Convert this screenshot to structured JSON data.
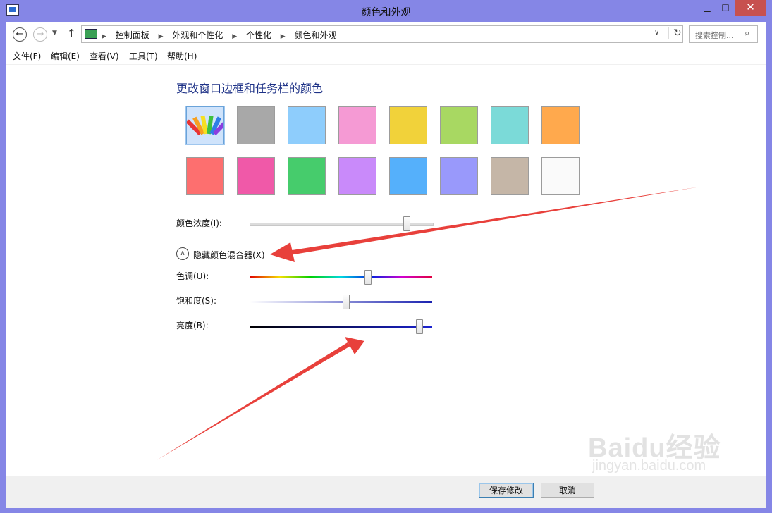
{
  "window": {
    "title": "颜色和外观"
  },
  "nav": {
    "back_icon": "back-arrow-icon",
    "forward_icon": "forward-arrow-icon",
    "up_icon": "up-arrow-icon",
    "breadcrumbs": [
      "控制面板",
      "外观和个性化",
      "个性化",
      "颜色和外观"
    ],
    "search_placeholder": "搜索控制..."
  },
  "menu": [
    "文件(F)",
    "编辑(E)",
    "查看(V)",
    "工具(T)",
    "帮助(H)"
  ],
  "content": {
    "heading": "更改窗口边框和任务栏的颜色",
    "swatches_row1": [
      "custom",
      "#a8a8a8",
      "#8ecdfc",
      "#f59ad4",
      "#f1d23a",
      "#a8d862",
      "#7bdad8",
      "#ffa94d"
    ],
    "swatches_row2": [
      "#fd6f6f",
      "#f059a8",
      "#46cc6c",
      "#c98afa",
      "#55b0fb",
      "#9999fb",
      "#c5b6a7",
      "#fafafa"
    ],
    "intensity_label": "颜色浓度(I):",
    "intensity_level": 0.86,
    "mixer_toggle": "隐藏颜色混合器(X)",
    "hue_label": "色调(U):",
    "hue_level": 0.65,
    "saturation_label": "饱和度(S):",
    "saturation_level": 0.53,
    "brightness_label": "亮度(B):",
    "brightness_level": 0.93
  },
  "footer": {
    "save": "保存修改",
    "cancel": "取消"
  },
  "watermark": {
    "logo": "Baidu经验",
    "url": "jingyan.baidu.com"
  },
  "colors": {
    "accent": "#1e3287",
    "frame": "#8586e6",
    "annotation_arrow": "#e8403b"
  }
}
